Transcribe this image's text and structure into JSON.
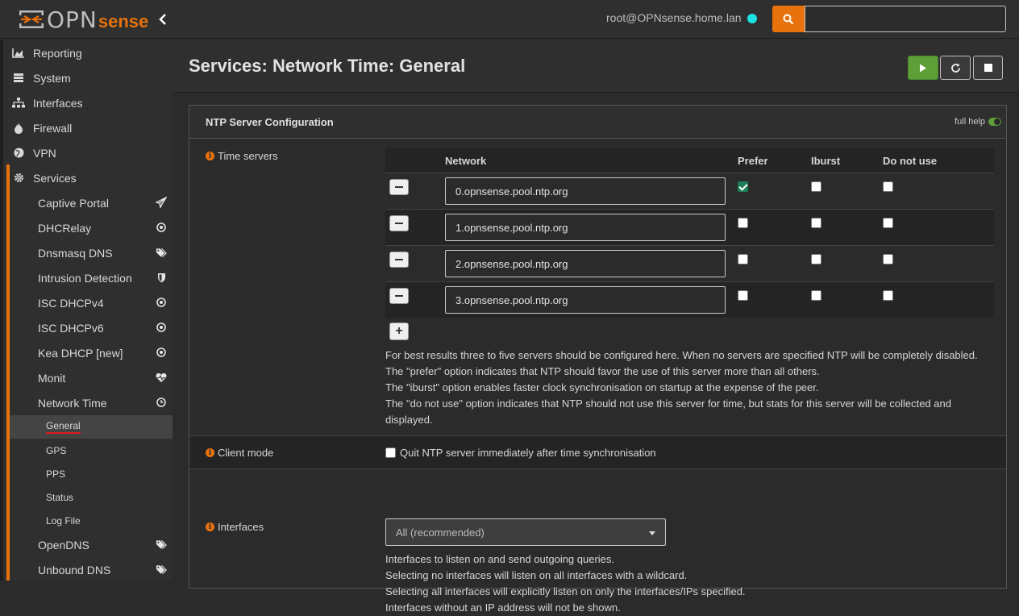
{
  "header": {
    "logo_main": "OPN",
    "logo_accent": "sense",
    "user": "root@OPNsense.home.lan",
    "search_placeholder": ""
  },
  "colors": {
    "accent": "#e8720c",
    "status_dot": "#1ee3e3",
    "play": "#5e9f37",
    "checked": "#1e7e58",
    "active_underline": "#e0191d"
  },
  "sidebar": {
    "top_items": [
      {
        "label": "Reporting",
        "icon": "area-chart-icon"
      },
      {
        "label": "System",
        "icon": "server-icon"
      },
      {
        "label": "Interfaces",
        "icon": "sitemap-icon"
      },
      {
        "label": "Firewall",
        "icon": "fire-icon"
      },
      {
        "label": "VPN",
        "icon": "globe-icon"
      },
      {
        "label": "Services",
        "icon": "cog-icon"
      }
    ],
    "services_items": [
      {
        "label": "Captive Portal",
        "icon": "paper-plane-icon"
      },
      {
        "label": "DHCRelay",
        "icon": "bullseye-icon"
      },
      {
        "label": "Dnsmasq DNS",
        "icon": "tags-icon"
      },
      {
        "label": "Intrusion Detection",
        "icon": "shield-icon"
      },
      {
        "label": "ISC DHCPv4",
        "icon": "bullseye-icon"
      },
      {
        "label": "ISC DHCPv6",
        "icon": "bullseye-icon"
      },
      {
        "label": "Kea DHCP [new]",
        "icon": "bullseye-icon"
      },
      {
        "label": "Monit",
        "icon": "heartbeat-icon"
      },
      {
        "label": "Network Time",
        "icon": "clock-icon"
      }
    ],
    "network_time_items": [
      "General",
      "GPS",
      "PPS",
      "Status",
      "Log File"
    ],
    "after_items": [
      {
        "label": "OpenDNS",
        "icon": "tags-icon"
      },
      {
        "label": "Unbound DNS",
        "icon": "tags-icon"
      }
    ]
  },
  "page": {
    "title": "Services: Network Time: General"
  },
  "panel": {
    "title": "NTP Server Configuration",
    "full_help": "full help",
    "time_servers_label": "Time servers",
    "columns": [
      "Network",
      "Prefer",
      "Iburst",
      "Do not use"
    ],
    "servers": [
      {
        "network": "0.opnsense.pool.ntp.org",
        "prefer": true,
        "iburst": false,
        "noselect": false
      },
      {
        "network": "1.opnsense.pool.ntp.org",
        "prefer": false,
        "iburst": false,
        "noselect": false
      },
      {
        "network": "2.opnsense.pool.ntp.org",
        "prefer": false,
        "iburst": false,
        "noselect": false
      },
      {
        "network": "3.opnsense.pool.ntp.org",
        "prefer": false,
        "iburst": false,
        "noselect": false
      }
    ],
    "ts_help": [
      "For best results three to five servers should be configured here. When no servers are specified NTP will be completely disabled.",
      "The \"prefer\" option indicates that NTP should favor the use of this server more than all others.",
      "The \"iburst\" option enables faster clock synchronisation on startup at the expense of the peer.",
      "The \"do not use\" option indicates that NTP should not use this server for time, but stats for this server will be collected and displayed."
    ],
    "client_mode_label": "Client mode",
    "client_mode_text": "Quit NTP server immediately after time synchronisation",
    "client_mode_checked": false,
    "interfaces_label": "Interfaces",
    "interfaces_value": "All (recommended)",
    "interfaces_help": [
      "Interfaces to listen on and send outgoing queries.",
      "Selecting no interfaces will listen on all interfaces with a wildcard.",
      "Selecting all interfaces will explicitly listen on only the interfaces/IPs specified.",
      "Interfaces without an IP address will not be shown."
    ]
  }
}
